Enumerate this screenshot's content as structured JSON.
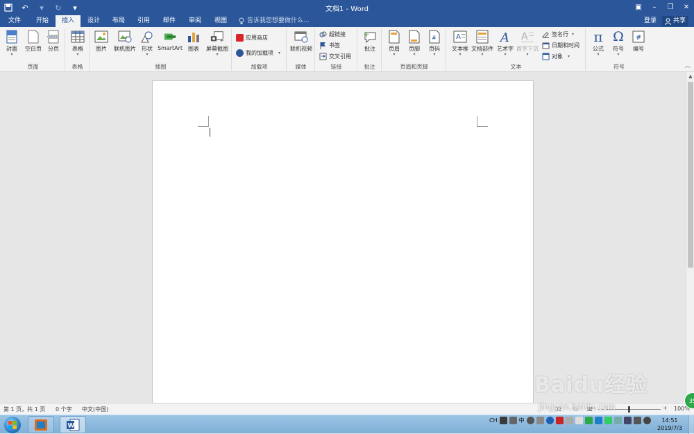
{
  "window": {
    "title": "文档1 - Word"
  },
  "tabs": [
    "文件",
    "开始",
    "插入",
    "设计",
    "布局",
    "引用",
    "邮件",
    "审阅",
    "视图"
  ],
  "tell_me": "告诉我您想要做什么...",
  "account": {
    "login": "登录",
    "share": "共享"
  },
  "ribbon": {
    "pages": {
      "label": "页面",
      "cover": "封面",
      "blank": "空白页",
      "break": "分页"
    },
    "tables": {
      "label": "表格",
      "table": "表格"
    },
    "illustrations": {
      "label": "插图",
      "pictures": "图片",
      "online_pictures": "联机图片",
      "shapes": "形状",
      "smartart": "SmartArt",
      "chart": "图表",
      "screenshot": "屏幕截图"
    },
    "addins": {
      "label": "加载项",
      "store": "应用商店",
      "my_addins": "我的加载项"
    },
    "media": {
      "label": "媒体",
      "online_video": "联机视频"
    },
    "links": {
      "label": "链接",
      "hyperlink": "超链接",
      "bookmark": "书签",
      "cross_ref": "交叉引用"
    },
    "comments": {
      "label": "批注",
      "comment": "批注"
    },
    "header_footer": {
      "label": "页眉和页脚",
      "header": "页眉",
      "footer": "页脚",
      "page_number": "页码"
    },
    "text": {
      "label": "文本",
      "textbox": "文本框",
      "quick_parts": "文档部件",
      "wordart": "艺术字",
      "dropcap": "首字下沉",
      "signature": "签名行",
      "datetime": "日期和时间",
      "object": "对象"
    },
    "symbols": {
      "label": "符号",
      "equation": "公式",
      "symbol": "符号",
      "number": "编号"
    }
  },
  "status": {
    "page": "第 1 页，共 1 页",
    "words": "0 个字",
    "lang": "中文(中国)",
    "zoom": "100%"
  },
  "taskbar": {
    "ime": "CH",
    "time": "14:51",
    "date": "2019/7/3"
  },
  "watermark": {
    "brand": "Baidu经验",
    "url": "jingyan.baidu.com",
    "badge": "35"
  },
  "colors": {
    "word_blue": "#2b579a",
    "ribbon_bg": "#f3f3f3"
  }
}
